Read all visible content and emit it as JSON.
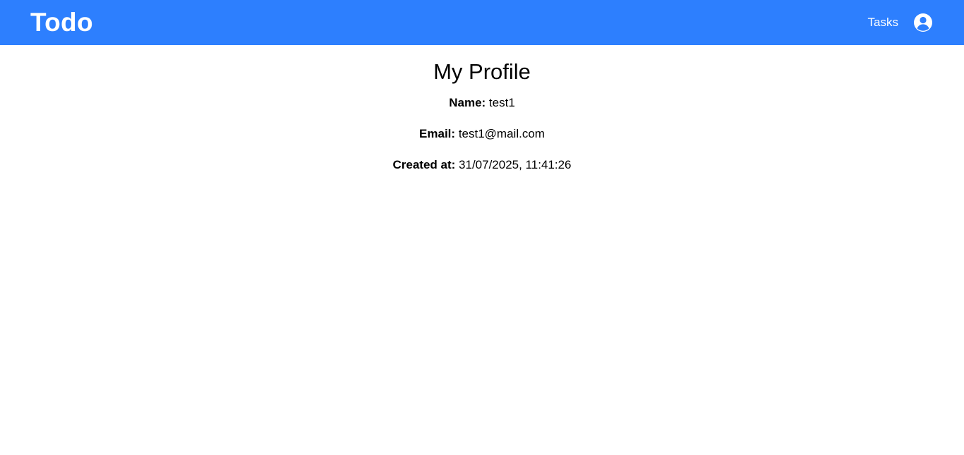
{
  "navbar": {
    "brand": "Todo",
    "links": [
      {
        "label": "Tasks"
      }
    ],
    "profile_icon": "user-circle-icon",
    "background_color": "#2d7ffe",
    "text_color": "#ffffff"
  },
  "profile": {
    "title": "My Profile",
    "name_label": "Name:",
    "name_value": "test1",
    "email_label": "Email:",
    "email_value": "test1@mail.com",
    "created_label": "Created at:",
    "created_value": "31/07/2025, 11:41:26"
  }
}
